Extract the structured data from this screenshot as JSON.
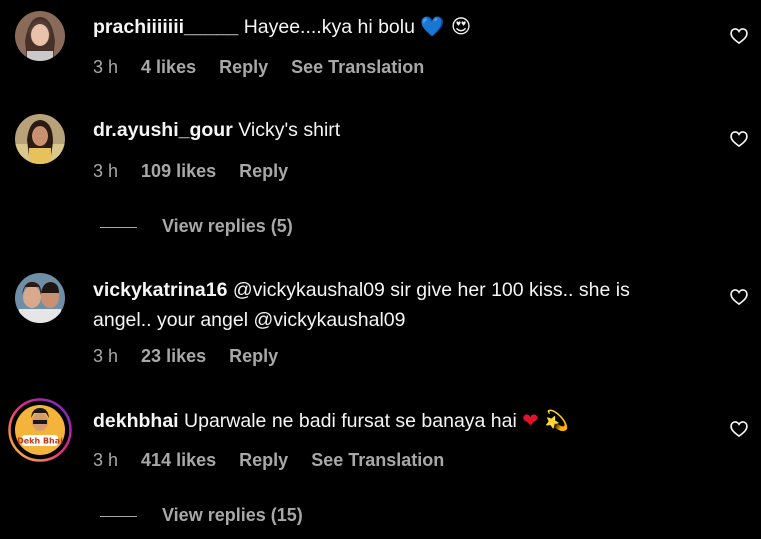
{
  "comments": [
    {
      "username": "prachiiiiiii_____",
      "text": "Hayee....kya hi bolu",
      "emojis": "💙  😍",
      "time": "3 h",
      "likes": "4 likes",
      "reply": "Reply",
      "translate": "See Translation"
    },
    {
      "username": "dr.ayushi_gour",
      "text": "Vicky's shirt",
      "time": "3 h",
      "likes": "109 likes",
      "reply": "Reply",
      "view_replies": "View replies (5)"
    },
    {
      "username": "vickykatrina16",
      "text": "@vickykaushal09 sir give her 100 kiss.. she is angel.. your angel @vickykaushal09",
      "time": "3 h",
      "likes": "23 likes",
      "reply": "Reply"
    },
    {
      "username": "dekhbhai",
      "text": "Uparwale ne badi fursat se banaya hai",
      "emojis": "❤ 💫",
      "avatar_text": "Dekh Bhai",
      "time": "3 h",
      "likes": "414 likes",
      "reply": "Reply",
      "translate": "See Translation",
      "view_replies": "View replies (15)"
    }
  ],
  "colors": {
    "background": "#000000",
    "text": "#f5f5f5",
    "secondary": "#a8a8a8",
    "story_ring_start": "#f9ce34",
    "story_ring_end": "#ee2a7b"
  },
  "icons": {
    "like": "heart-outline-icon"
  }
}
